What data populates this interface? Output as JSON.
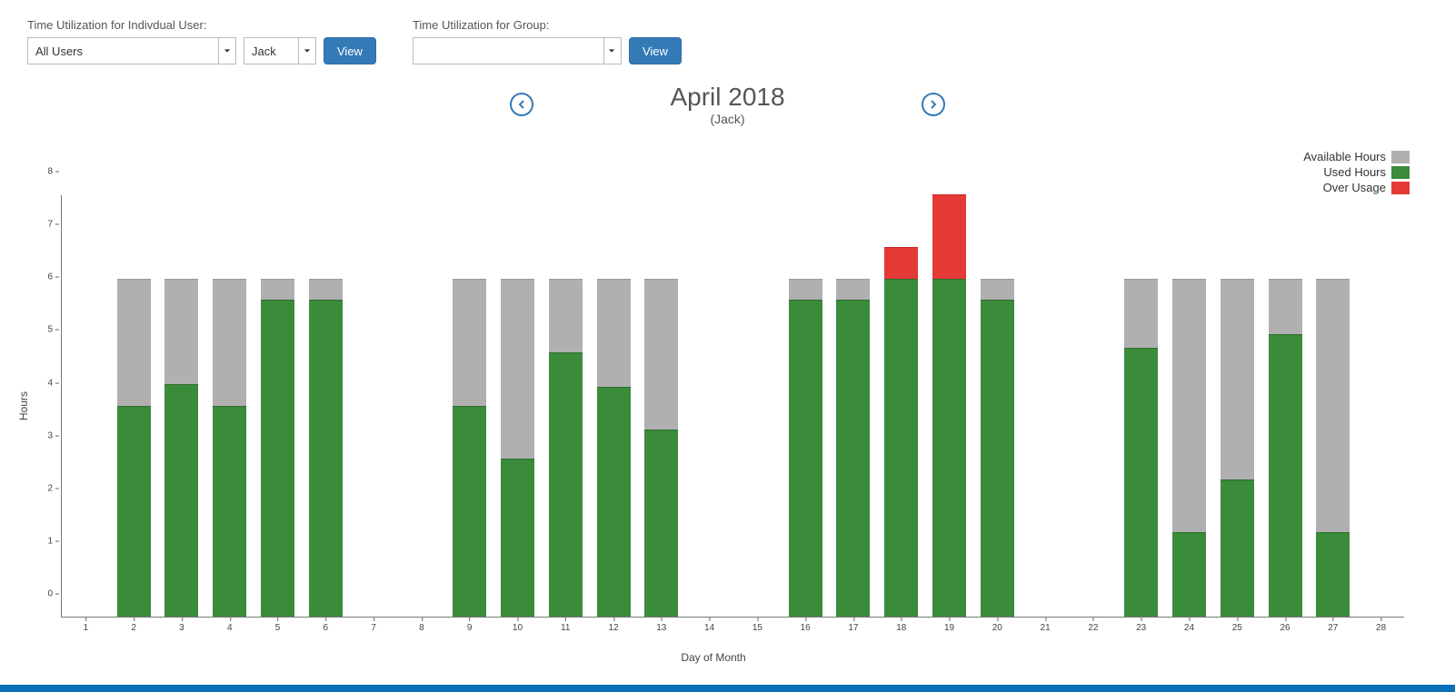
{
  "controls": {
    "individual_label": "Time Utilization for Indivdual User:",
    "group_label": "Time Utilization for Group:",
    "select_all_users": "All Users",
    "select_user": "Jack",
    "select_group": "",
    "view_btn": "View"
  },
  "title": {
    "main": "April 2018",
    "sub": "(Jack)"
  },
  "legend": {
    "available": "Available Hours",
    "used": "Used Hours",
    "over": "Over Usage"
  },
  "axes": {
    "y_label": "Hours",
    "x_label": "Day of Month"
  },
  "colors": {
    "available": "#b0b0b0",
    "used": "#3a8b3a",
    "over": "#e53935",
    "accent": "#337ab7"
  },
  "chart_data": {
    "type": "bar",
    "stacked": true,
    "title": "April 2018 (Jack)",
    "xlabel": "Day of Month",
    "ylabel": "Hours",
    "ylim": [
      0,
      8
    ],
    "yticks": [
      0,
      1,
      2,
      3,
      4,
      5,
      6,
      7,
      8
    ],
    "categories": [
      1,
      2,
      3,
      4,
      5,
      6,
      7,
      8,
      9,
      10,
      11,
      12,
      13,
      14,
      15,
      16,
      17,
      18,
      19,
      20,
      21,
      22,
      23,
      24,
      25,
      26,
      27,
      28
    ],
    "available_cap": 6.4,
    "series": [
      {
        "name": "Used Hours",
        "values": [
          null,
          4.0,
          4.4,
          4.0,
          6.0,
          6.0,
          null,
          null,
          4.0,
          3.0,
          5.0,
          4.35,
          3.55,
          null,
          null,
          6.0,
          6.0,
          6.4,
          6.4,
          6.0,
          null,
          null,
          5.1,
          1.6,
          2.6,
          5.35,
          1.6,
          null
        ]
      },
      {
        "name": "Available Hours",
        "values": [
          null,
          2.4,
          2.0,
          2.4,
          0.4,
          0.4,
          null,
          null,
          2.4,
          3.4,
          1.4,
          2.05,
          2.85,
          null,
          null,
          0.4,
          0.4,
          0.0,
          0.0,
          0.4,
          null,
          null,
          1.3,
          4.8,
          3.8,
          1.05,
          4.8,
          null
        ]
      },
      {
        "name": "Over Usage",
        "values": [
          null,
          0,
          0,
          0,
          0,
          0,
          null,
          null,
          0,
          0,
          0,
          0,
          0,
          null,
          null,
          0,
          0,
          0.6,
          1.6,
          0,
          null,
          null,
          0,
          0,
          0,
          0,
          0,
          null
        ]
      }
    ],
    "legend_position": "top-right",
    "grid": false
  }
}
